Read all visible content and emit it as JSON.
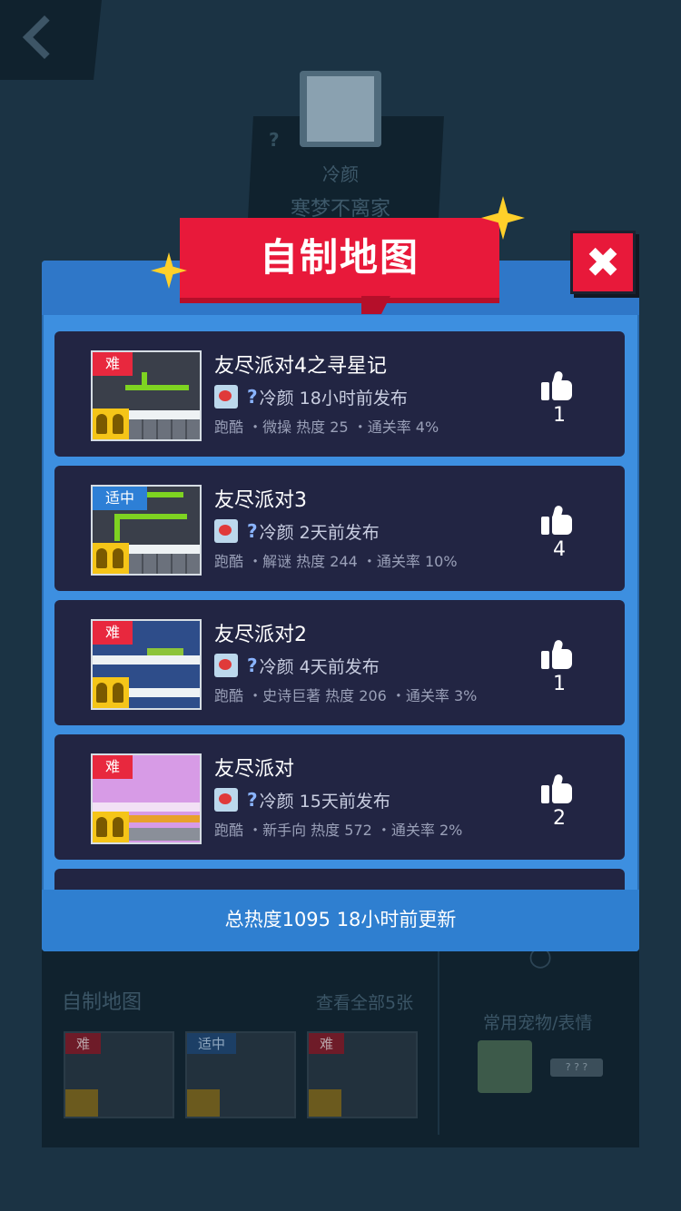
{
  "background": {
    "profile_name": "冷颜",
    "profile_signature": "寒梦不离家",
    "section_title": "自制地图",
    "view_all": "查看全部5张",
    "pets_label": "常用宠物/表情",
    "pets_placeholder": "? ? ?",
    "thumb_levels": [
      "难",
      "适中",
      "难"
    ]
  },
  "modal": {
    "title": "自制地图",
    "footer": "总热度1095 18小时前更新"
  },
  "maps": [
    {
      "difficulty": "难",
      "difficulty_type": "hard",
      "title": "友尽派对4之寻星记",
      "author": "冷颜 18小时前发布",
      "meta": "跑酷 ・微操 热度 25 ・通关率 4%",
      "likes": "1"
    },
    {
      "difficulty": "适中",
      "difficulty_type": "mid",
      "title": "友尽派对3",
      "author": "冷颜 2天前发布",
      "meta": "跑酷 ・解谜 热度 244 ・通关率 10%",
      "likes": "4"
    },
    {
      "difficulty": "难",
      "difficulty_type": "hard",
      "title": "友尽派对2",
      "author": "冷颜 4天前发布",
      "meta": "跑酷 ・史诗巨著 热度 206 ・通关率 3%",
      "likes": "1"
    },
    {
      "difficulty": "难",
      "difficulty_type": "hard",
      "title": "友尽派对",
      "author": "冷颜 15天前发布",
      "meta": "跑酷 ・新手向 热度 572 ・通关率 2%",
      "likes": "2"
    }
  ],
  "icons": {
    "back": "chevron-left-icon",
    "close": "close-icon",
    "like": "thumbs-up-icon",
    "unknown": "question-mark-icon"
  },
  "colors": {
    "hard": "#e8283e",
    "mid": "#2d7fd6",
    "modal": "#3d8fe0",
    "card": "#222543",
    "banner": "#e8193a"
  }
}
